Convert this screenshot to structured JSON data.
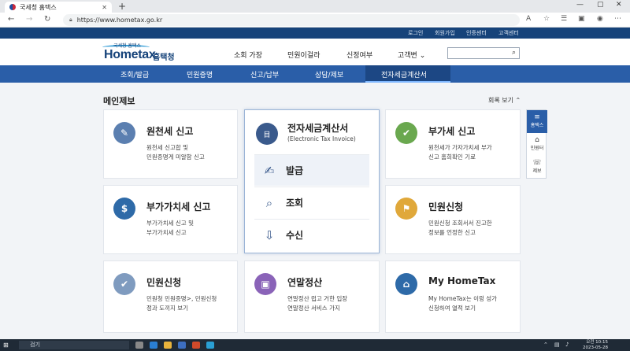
{
  "browser": {
    "tab_title": "국세청 홈택스",
    "tab_close": "✕",
    "new_tab": "+",
    "url": "https://www.hometax.go.kr"
  },
  "util_links": [
    "로그인",
    "회원가입",
    "인증센터",
    "고객센터"
  ],
  "logo": {
    "small": "국세청 홈택스",
    "main": "Hometax",
    "kr": "홈택청"
  },
  "gnb": [
    "소회 가장",
    "민원이걸라",
    "신정여부",
    "고객변 ⌄"
  ],
  "menu": [
    "조회/발급",
    "민원증명",
    "신고/납부",
    "상담/제보",
    "전자세금계산서"
  ],
  "section": {
    "title": "메인제보",
    "collapse": "회록 보기 ⌃"
  },
  "cards": [
    {
      "title": "원천세 신고",
      "desc1": "원천세 신고합 및",
      "desc2": "민원증명게 미알함 신고",
      "color": "#5b7fb0",
      "glyph": "✎"
    },
    {
      "title": "부가세 신고",
      "desc1": "원천세가 가자가치세 부가",
      "desc2": "신고 홈희확인 기료",
      "color": "#6aa84f",
      "glyph": "✔"
    },
    {
      "title": "부가가치세 신고",
      "desc1": "부가가치세 신고 및",
      "desc2": "부가가치세 신고",
      "color": "#2e6aa8",
      "glyph": "$"
    },
    {
      "title": "민원신청",
      "desc1": "민원신청 조회서서 진고한",
      "desc2": "정보를 언정한 신고",
      "color": "#e0a83a",
      "glyph": "⚑"
    },
    {
      "title": "민원신청",
      "desc1": "민원청 민원증명>, 민원신청",
      "desc2": "정과 도끼지 보기",
      "color": "#7f9bbf",
      "glyph": "✔"
    },
    {
      "title": "연말정산",
      "desc1": "연말정산 럽고 거한 입장",
      "desc2": "연말정산 서비스 가지",
      "color": "#8a63b8",
      "glyph": "▣"
    },
    {
      "title": "My HomeTax",
      "desc1": "My HomeTax는 이렁 성가",
      "desc2": "신청하여 열적 보기",
      "color": "#2e6aa8",
      "glyph": "⌂"
    }
  ],
  "feature": {
    "title": "전자세금계산서",
    "subtitle": "(Electronic Tax Invoice)",
    "icon_text": "目",
    "rows": [
      {
        "label": "발급",
        "glyph": "✍"
      },
      {
        "label": "조회",
        "glyph": "⌕"
      },
      {
        "label": "수신",
        "glyph": "⇩"
      }
    ]
  },
  "quick": [
    {
      "label": "홈택스",
      "glyph": "≡"
    },
    {
      "label": "인원터",
      "glyph": "⌂"
    },
    {
      "label": "제보",
      "glyph": "☏"
    }
  ],
  "taskbar": {
    "search": "검기",
    "time": "오전 10:15",
    "date": "2023-05-28"
  }
}
